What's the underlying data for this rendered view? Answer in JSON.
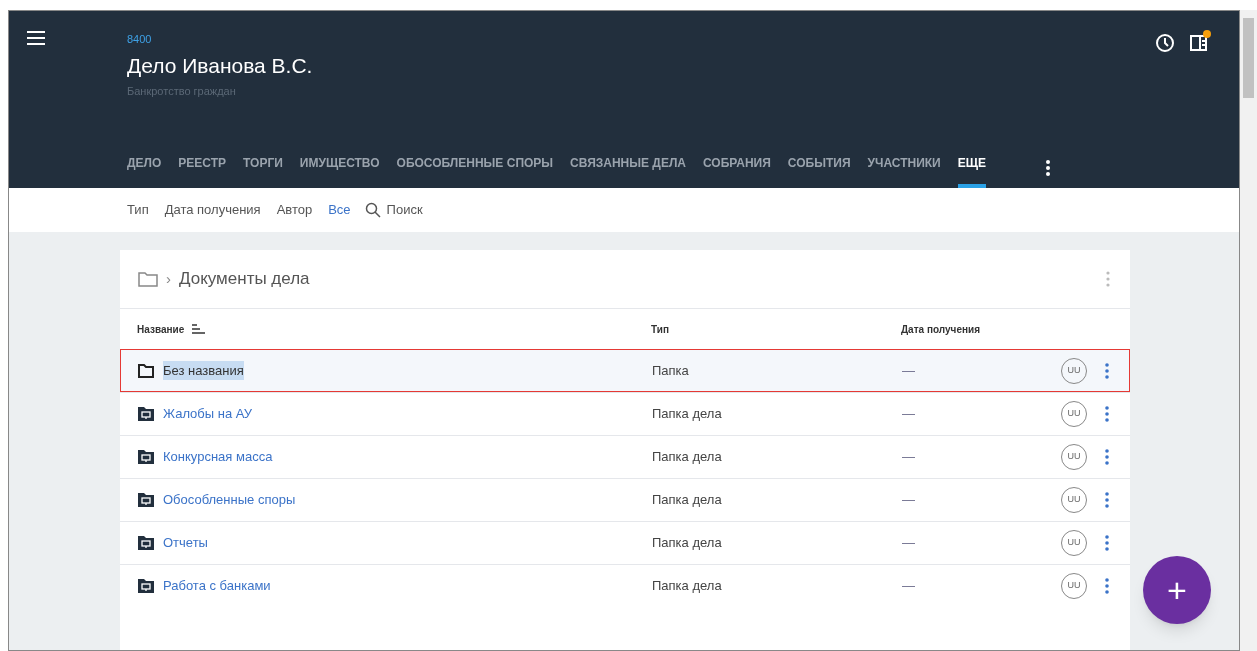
{
  "header": {
    "case_number": "8400",
    "title": "Дело Иванова В.С.",
    "subtitle": "Банкротство граждан",
    "has_notification": true
  },
  "tabs": [
    {
      "label": "ДЕЛО",
      "selected": false
    },
    {
      "label": "РЕЕСТР",
      "selected": false
    },
    {
      "label": "ТОРГИ",
      "selected": false
    },
    {
      "label": "ИМУЩЕСТВО",
      "selected": false
    },
    {
      "label": "ОБОСОБЛЕННЫЕ СПОРЫ",
      "selected": false
    },
    {
      "label": "СВЯЗАННЫЕ ДЕЛА",
      "selected": false
    },
    {
      "label": "СОБРАНИЯ",
      "selected": false
    },
    {
      "label": "СОБЫТИЯ",
      "selected": false
    },
    {
      "label": "УЧАСТНИКИ",
      "selected": false
    },
    {
      "label": "ЕЩЕ",
      "selected": true
    }
  ],
  "filters": [
    {
      "label": "Тип",
      "selected": false
    },
    {
      "label": "Дата получения",
      "selected": false
    },
    {
      "label": "Автор",
      "selected": false
    },
    {
      "label": "Все",
      "selected": true
    }
  ],
  "search": {
    "placeholder": "Поиск"
  },
  "breadcrumb": {
    "separator": "›",
    "title": "Документы дела"
  },
  "table": {
    "columns": [
      "Название",
      "Тип",
      "Дата получения"
    ],
    "rows": [
      {
        "kind": "folder",
        "name": "Без названия",
        "type": "Папка",
        "date": "—",
        "author": "UU",
        "selected": true
      },
      {
        "kind": "case_folder",
        "name": "Жалобы на АУ",
        "type": "Папка дела",
        "date": "—",
        "author": "UU",
        "selected": false
      },
      {
        "kind": "case_folder",
        "name": "Конкурсная масса",
        "type": "Папка дела",
        "date": "—",
        "author": "UU",
        "selected": false
      },
      {
        "kind": "case_folder",
        "name": "Обособленные споры",
        "type": "Папка дела",
        "date": "—",
        "author": "UU",
        "selected": false
      },
      {
        "kind": "case_folder",
        "name": "Отчеты",
        "type": "Папка дела",
        "date": "—",
        "author": "UU",
        "selected": false
      },
      {
        "kind": "case_folder",
        "name": "Работа с банками",
        "type": "Папка дела",
        "date": "—",
        "author": "UU",
        "selected": false
      }
    ]
  },
  "fab": {
    "label": "+"
  }
}
